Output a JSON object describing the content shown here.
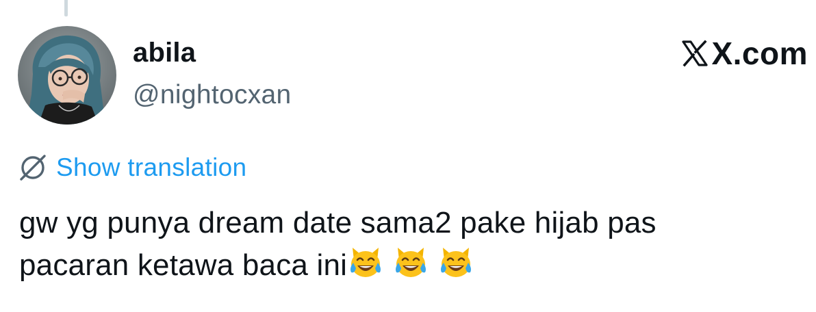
{
  "header": {
    "display_name": "abila",
    "handle": "@nightocxan",
    "brand": "X.com",
    "brand_icon": "x-logo-icon"
  },
  "translation": {
    "icon": "globe-icon",
    "label": "Show translation"
  },
  "tweet": {
    "line1": "gw yg punya dream date sama2 pake hijab pas",
    "line2": "pacaran ketawa baca ini",
    "emojis": [
      "cat-tears-of-joy",
      "cat-tears-of-joy",
      "cat-tears-of-joy"
    ]
  },
  "colors": {
    "text": "#0f1419",
    "secondary": "#536471",
    "link": "#1d9bf0",
    "thread_line": "#cfd9de"
  }
}
